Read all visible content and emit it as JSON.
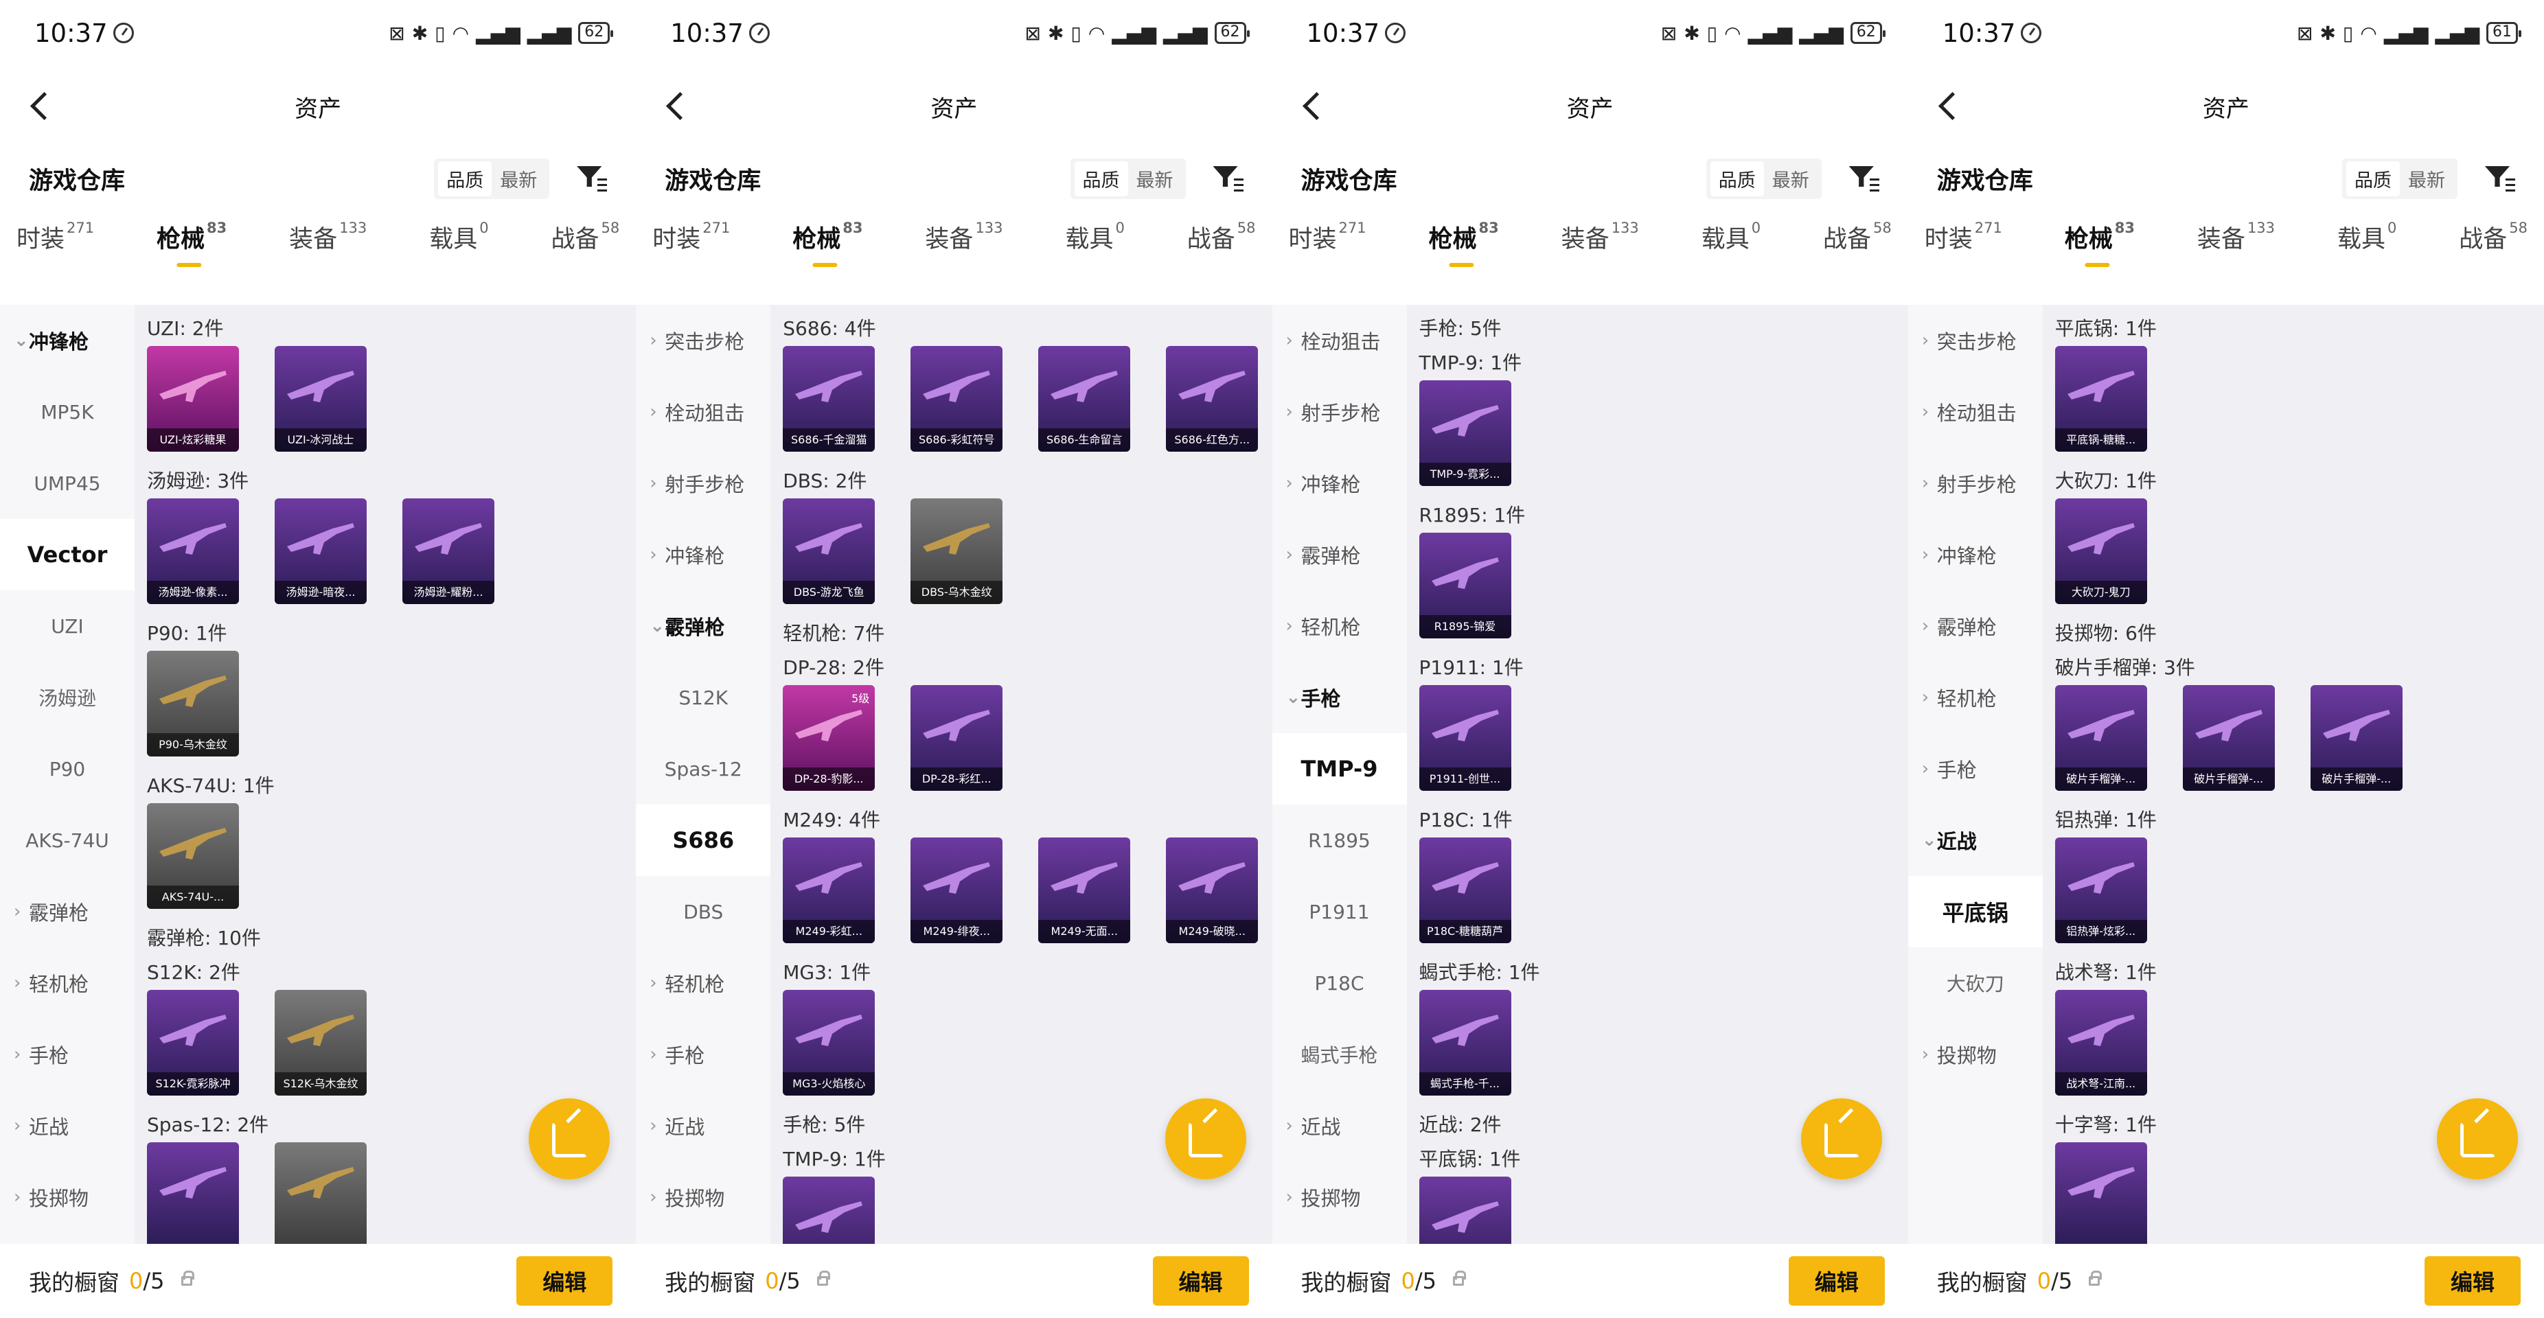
{
  "colors": {
    "accent": "#f6b80e",
    "tab_indicator": "#f2b800"
  },
  "screens": [
    {
      "status": {
        "time": "10:37",
        "battery": "62"
      },
      "title": "资产",
      "warehouse": {
        "title": "游戏仓库",
        "sort_quality": "品质",
        "sort_latest": "最新"
      },
      "tabs": [
        {
          "label": "时装",
          "count": "271"
        },
        {
          "label": "枪械",
          "count": "83"
        },
        {
          "label": "装备",
          "count": "133"
        },
        {
          "label": "载具",
          "count": "0"
        },
        {
          "label": "战备",
          "count": "58"
        }
      ],
      "active_tab": 1,
      "side": [
        {
          "type": "cat",
          "label": "冲锋枪",
          "open": true
        },
        {
          "type": "sub",
          "label": "MP5K"
        },
        {
          "type": "sub",
          "label": "UMP45"
        },
        {
          "type": "sub",
          "label": "Vector",
          "selected": true
        },
        {
          "type": "sub",
          "label": "UZI"
        },
        {
          "type": "sub",
          "label": "汤姆逊"
        },
        {
          "type": "sub",
          "label": "P90"
        },
        {
          "type": "sub",
          "label": "AKS-74U"
        },
        {
          "type": "cat",
          "label": "霰弹枪"
        },
        {
          "type": "cat",
          "label": "轻机枪"
        },
        {
          "type": "cat",
          "label": "手枪"
        },
        {
          "type": "cat",
          "label": "近战"
        },
        {
          "type": "cat",
          "label": "投掷物"
        }
      ],
      "groups": [
        {
          "label": "UZI: 2件",
          "items": [
            {
              "cap": "UZI-炫彩糖果",
              "style": "pink"
            },
            {
              "cap": "UZI-冰河战士",
              "style": "purple"
            }
          ]
        },
        {
          "label": "汤姆逊: 3件",
          "items": [
            {
              "cap": "汤姆逊-像素...",
              "style": "purple"
            },
            {
              "cap": "汤姆逊-暗夜...",
              "style": "purple"
            },
            {
              "cap": "汤姆逊-耀粉...",
              "style": "purple"
            }
          ]
        },
        {
          "label": "P90: 1件",
          "items": [
            {
              "cap": "P90-乌木金纹",
              "style": "grey"
            }
          ]
        },
        {
          "label": "AKS-74U: 1件",
          "items": [
            {
              "cap": "AKS-74U-...",
              "style": "grey"
            }
          ]
        },
        {
          "label": "霰弹枪: 10件",
          "items": []
        },
        {
          "label": "S12K: 2件",
          "items": [
            {
              "cap": "S12K-霓彩脉冲",
              "style": "purple"
            },
            {
              "cap": "S12K-乌木金纹",
              "style": "grey"
            }
          ]
        },
        {
          "label": "Spas-12: 2件",
          "items": [
            {
              "cap": "",
              "style": "purple"
            },
            {
              "cap": "",
              "style": "grey"
            }
          ]
        }
      ],
      "bottom": {
        "label": "我的橱窗",
        "count": "0",
        "total": "/5",
        "edit": "编辑"
      }
    },
    {
      "status": {
        "time": "10:37",
        "battery": "62"
      },
      "title": "资产",
      "warehouse": {
        "title": "游戏仓库",
        "sort_quality": "品质",
        "sort_latest": "最新"
      },
      "tabs": [
        {
          "label": "时装",
          "count": "271"
        },
        {
          "label": "枪械",
          "count": "83"
        },
        {
          "label": "装备",
          "count": "133"
        },
        {
          "label": "载具",
          "count": "0"
        },
        {
          "label": "战备",
          "count": "58"
        }
      ],
      "active_tab": 1,
      "side": [
        {
          "type": "cat",
          "label": "突击步枪"
        },
        {
          "type": "cat",
          "label": "栓动狙击"
        },
        {
          "type": "cat",
          "label": "射手步枪"
        },
        {
          "type": "cat",
          "label": "冲锋枪"
        },
        {
          "type": "cat",
          "label": "霰弹枪",
          "open": true
        },
        {
          "type": "sub",
          "label": "S12K"
        },
        {
          "type": "sub",
          "label": "Spas-12"
        },
        {
          "type": "sub",
          "label": "S686",
          "selected": true
        },
        {
          "type": "sub",
          "label": "DBS"
        },
        {
          "type": "cat",
          "label": "轻机枪"
        },
        {
          "type": "cat",
          "label": "手枪"
        },
        {
          "type": "cat",
          "label": "近战"
        },
        {
          "type": "cat",
          "label": "投掷物"
        }
      ],
      "groups": [
        {
          "label": "S686: 4件",
          "items": [
            {
              "cap": "S686-千金溜猫",
              "style": "purple"
            },
            {
              "cap": "S686-彩虹符号",
              "style": "purple"
            },
            {
              "cap": "S686-生命留言",
              "style": "purple"
            },
            {
              "cap": "S686-红色方...",
              "style": "purple"
            }
          ]
        },
        {
          "label": "DBS: 2件",
          "items": [
            {
              "cap": "DBS-游龙飞鱼",
              "style": "purple"
            },
            {
              "cap": "DBS-乌木金纹",
              "style": "grey"
            }
          ]
        },
        {
          "label": "轻机枪: 7件",
          "items": []
        },
        {
          "label": "DP-28: 2件",
          "items": [
            {
              "cap": "DP-28-豹影...",
              "style": "pink",
              "lvl": "5级"
            },
            {
              "cap": "DP-28-彩红...",
              "style": "purple"
            }
          ]
        },
        {
          "label": "M249: 4件",
          "items": [
            {
              "cap": "M249-彩虹...",
              "style": "purple"
            },
            {
              "cap": "M249-绯夜...",
              "style": "purple"
            },
            {
              "cap": "M249-无面...",
              "style": "purple"
            },
            {
              "cap": "M249-破晓...",
              "style": "purple"
            }
          ]
        },
        {
          "label": "MG3: 1件",
          "items": [
            {
              "cap": "MG3-火焰核心",
              "style": "purple"
            }
          ]
        },
        {
          "label": "手枪: 5件",
          "items": []
        },
        {
          "label": "TMP-9: 1件",
          "items": [
            {
              "cap": "",
              "style": "purple"
            }
          ]
        }
      ],
      "bottom": {
        "label": "我的橱窗",
        "count": "0",
        "total": "/5",
        "edit": "编辑"
      }
    },
    {
      "status": {
        "time": "10:37",
        "battery": "62"
      },
      "title": "资产",
      "warehouse": {
        "title": "游戏仓库",
        "sort_quality": "品质",
        "sort_latest": "最新"
      },
      "tabs": [
        {
          "label": "时装",
          "count": "271"
        },
        {
          "label": "枪械",
          "count": "83"
        },
        {
          "label": "装备",
          "count": "133"
        },
        {
          "label": "载具",
          "count": "0"
        },
        {
          "label": "战备",
          "count": "58"
        }
      ],
      "active_tab": 1,
      "side": [
        {
          "type": "cat",
          "label": "栓动狙击"
        },
        {
          "type": "cat",
          "label": "射手步枪"
        },
        {
          "type": "cat",
          "label": "冲锋枪"
        },
        {
          "type": "cat",
          "label": "霰弹枪"
        },
        {
          "type": "cat",
          "label": "轻机枪"
        },
        {
          "type": "cat",
          "label": "手枪",
          "open": true
        },
        {
          "type": "sub",
          "label": "TMP-9",
          "selected": true
        },
        {
          "type": "sub",
          "label": "R1895"
        },
        {
          "type": "sub",
          "label": "P1911"
        },
        {
          "type": "sub",
          "label": "P18C"
        },
        {
          "type": "sub",
          "label": "蝎式手枪"
        },
        {
          "type": "cat",
          "label": "近战"
        },
        {
          "type": "cat",
          "label": "投掷物"
        }
      ],
      "groups": [
        {
          "label": "手枪: 5件",
          "items": []
        },
        {
          "label": "TMP-9: 1件",
          "items": [
            {
              "cap": "TMP-9-霓彩...",
              "style": "purple"
            }
          ]
        },
        {
          "label": "R1895: 1件",
          "items": [
            {
              "cap": "R1895-锦爱",
              "style": "purple"
            }
          ]
        },
        {
          "label": "P1911: 1件",
          "items": [
            {
              "cap": "P1911-创世...",
              "style": "purple"
            }
          ]
        },
        {
          "label": "P18C: 1件",
          "items": [
            {
              "cap": "P18C-糖糖葫芦",
              "style": "purple"
            }
          ]
        },
        {
          "label": "蝎式手枪: 1件",
          "items": [
            {
              "cap": "蝎式手枪-千...",
              "style": "purple"
            }
          ]
        },
        {
          "label": "近战: 2件",
          "items": []
        },
        {
          "label": "平底锅: 1件",
          "items": [
            {
              "cap": "",
              "style": "purple"
            }
          ]
        }
      ],
      "bottom": {
        "label": "我的橱窗",
        "count": "0",
        "total": "/5",
        "edit": "编辑"
      }
    },
    {
      "status": {
        "time": "10:37",
        "battery": "61"
      },
      "title": "资产",
      "warehouse": {
        "title": "游戏仓库",
        "sort_quality": "品质",
        "sort_latest": "最新"
      },
      "tabs": [
        {
          "label": "时装",
          "count": "271"
        },
        {
          "label": "枪械",
          "count": "83"
        },
        {
          "label": "装备",
          "count": "133"
        },
        {
          "label": "载具",
          "count": "0"
        },
        {
          "label": "战备",
          "count": "58"
        }
      ],
      "active_tab": 1,
      "side": [
        {
          "type": "cat",
          "label": "突击步枪"
        },
        {
          "type": "cat",
          "label": "栓动狙击"
        },
        {
          "type": "cat",
          "label": "射手步枪"
        },
        {
          "type": "cat",
          "label": "冲锋枪"
        },
        {
          "type": "cat",
          "label": "霰弹枪"
        },
        {
          "type": "cat",
          "label": "轻机枪"
        },
        {
          "type": "cat",
          "label": "手枪"
        },
        {
          "type": "cat",
          "label": "近战",
          "open": true
        },
        {
          "type": "sub",
          "label": "平底锅",
          "selected": true
        },
        {
          "type": "sub",
          "label": "大砍刀"
        },
        {
          "type": "cat",
          "label": "投掷物"
        }
      ],
      "groups": [
        {
          "label": "平底锅: 1件",
          "items": [
            {
              "cap": "平底锅-糖糖...",
              "style": "purple"
            }
          ]
        },
        {
          "label": "大砍刀: 1件",
          "items": [
            {
              "cap": "大砍刀-鬼刀",
              "style": "purple"
            }
          ]
        },
        {
          "label": "投掷物: 6件",
          "items": []
        },
        {
          "label": "破片手榴弹: 3件",
          "items": [
            {
              "cap": "破片手榴弹-...",
              "style": "purple"
            },
            {
              "cap": "破片手榴弹-...",
              "style": "purple"
            },
            {
              "cap": "破片手榴弹-...",
              "style": "purple"
            }
          ]
        },
        {
          "label": "铝热弹: 1件",
          "items": [
            {
              "cap": "铝热弹-炫彩...",
              "style": "purple"
            }
          ]
        },
        {
          "label": "战术弩: 1件",
          "items": [
            {
              "cap": "战术弩-江南...",
              "style": "purple"
            }
          ]
        },
        {
          "label": "十字弩: 1件",
          "items": [
            {
              "cap": "",
              "style": "purple"
            }
          ]
        }
      ],
      "bottom": {
        "label": "我的橱窗",
        "count": "0",
        "total": "/5",
        "edit": "编辑"
      }
    }
  ]
}
